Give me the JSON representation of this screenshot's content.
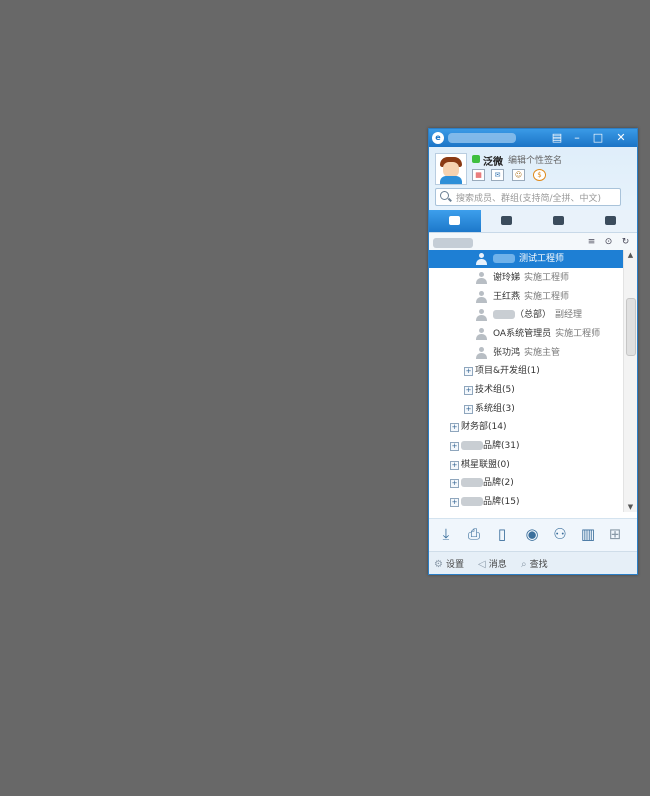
{
  "user": {
    "name": "泛微",
    "signature": "编辑个性签名"
  },
  "search": {
    "placeholder": "搜索成员、群组(支持简/全拼、中文)"
  },
  "tabs": [
    {
      "icon": "org-tree-icon"
    },
    {
      "icon": "chat-icon"
    },
    {
      "icon": "message-icon"
    },
    {
      "icon": "notice-icon"
    }
  ],
  "contacts": [
    {
      "name": "",
      "title": "测试工程师",
      "selected": true
    },
    {
      "name": "谢玲娣",
      "title": "实施工程师"
    },
    {
      "name": "王红燕",
      "title": "实施工程师"
    },
    {
      "name": "（总部）",
      "title": "副经理"
    },
    {
      "name": "OA系统管理员",
      "title": "实施工程师"
    },
    {
      "name": "张功鸿",
      "title": "实施主管"
    }
  ],
  "groups_sub": [
    {
      "label": "项目&开发组",
      "count": "(1)"
    },
    {
      "label": "技术组",
      "count": "(5)"
    },
    {
      "label": "系统组",
      "count": "(3)"
    }
  ],
  "groups_top": [
    {
      "label": "财务部",
      "count": "(14)"
    },
    {
      "label": "品牌",
      "count": "(31)"
    },
    {
      "label": "棋星联盟",
      "count": "(0)"
    },
    {
      "label": "品牌",
      "count": "(2)"
    },
    {
      "label": "品牌",
      "count": "(15)"
    }
  ],
  "status_bar": {
    "settings": "设置",
    "messages": "消息",
    "find": "查找"
  },
  "colors": {
    "accent": "#1e7fd4",
    "online": "#3fbf3f",
    "desktop": "#686868"
  }
}
